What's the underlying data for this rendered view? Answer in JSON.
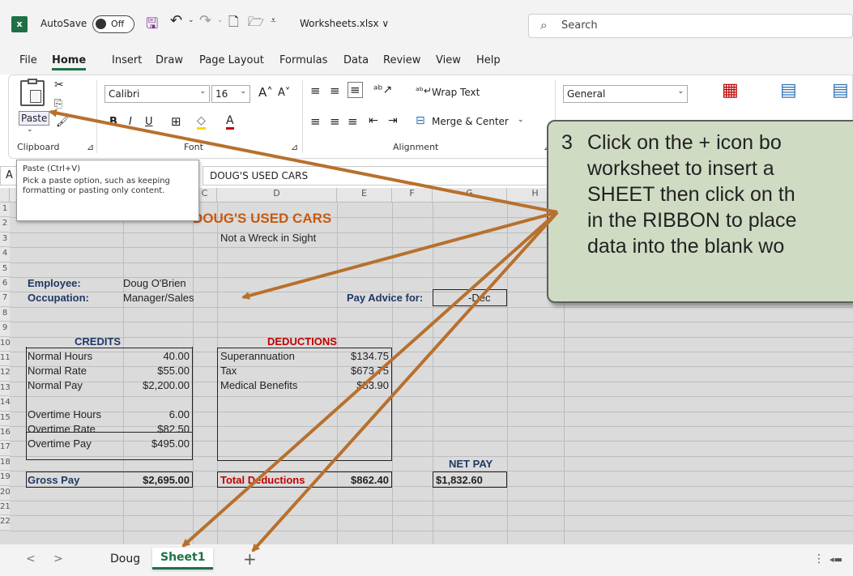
{
  "titlebar": {
    "autosave": "AutoSave",
    "toggle": "Off",
    "filename": "Worksheets.xlsx ∨",
    "search": "Search"
  },
  "menu": [
    "File",
    "Home",
    "Insert",
    "Draw",
    "Page Layout",
    "Formulas",
    "Data",
    "Review",
    "View",
    "Help"
  ],
  "ribbon": {
    "paste": "Paste",
    "font": "Calibri",
    "size": "16",
    "wrap": "Wrap Text",
    "merge": "Merge & Center",
    "format": "General",
    "groups": {
      "clipboard": "Clipboard",
      "font": "Font",
      "alignment": "Alignment"
    }
  },
  "namebox": "A",
  "formula": "DOUG'S USED CARS",
  "tooltip": {
    "title": "Paste (Ctrl+V)",
    "body": "Pick a paste option, such as keeping formatting or pasting only content."
  },
  "columns": [
    "C",
    "D",
    "E",
    "F",
    "G",
    "H"
  ],
  "rows": [
    "1",
    "2",
    "3",
    "4",
    "5",
    "6",
    "7",
    "8",
    "9",
    "10",
    "11",
    "12",
    "13",
    "14",
    "15",
    "16",
    "17",
    "18",
    "19",
    "20",
    "21",
    "22"
  ],
  "sheet": {
    "title": "DOUG'S USED CARS",
    "subtitle": "Not a Wreck in Sight",
    "employee_label": "Employee:",
    "employee": "Doug O'Brien",
    "occupation_label": "Occupation:",
    "occupation": "Manager/Sales",
    "pay_advice": "Pay Advice for:",
    "pay_advice_date": "-Dec",
    "credits": "CREDITS",
    "deductions": "DEDUCTIONS",
    "credit_rows": [
      [
        "Normal Hours",
        "40.00"
      ],
      [
        "Normal Rate",
        "$55.00"
      ],
      [
        "Normal Pay",
        "$2,200.00"
      ],
      [
        "Overtime Hours",
        "6.00"
      ],
      [
        "Overtime Rate",
        "$82.50"
      ],
      [
        "Overtime Pay",
        "$495.00"
      ]
    ],
    "deduction_rows": [
      [
        "Superannuation",
        "$134.75"
      ],
      [
        "Tax",
        "$673.75"
      ],
      [
        "Medical Benefits",
        "$53.90"
      ]
    ],
    "gross_label": "Gross Pay",
    "gross": "$2,695.00",
    "total_ded_label": "Total Deductions",
    "total_ded": "$862.40",
    "net_label": "NET PAY",
    "net": "$1,832.60"
  },
  "tabs": {
    "nav_prev": "<",
    "nav_next": ">",
    "sheet1": "Doug",
    "sheet2": "Sheet1",
    "add": "+"
  },
  "callout": {
    "number": "3",
    "text": "Click on the + icon bo\nworksheet to insert a\nSHEET then click on th\nin the RIBBON to place\ndata into the blank wo"
  },
  "colors": {
    "title": "#c55a11",
    "credits": "#1f3864",
    "deductions": "#c00000",
    "net": "#1f3864",
    "callout": "#d0dbc4",
    "arrow": "#b8702e"
  }
}
